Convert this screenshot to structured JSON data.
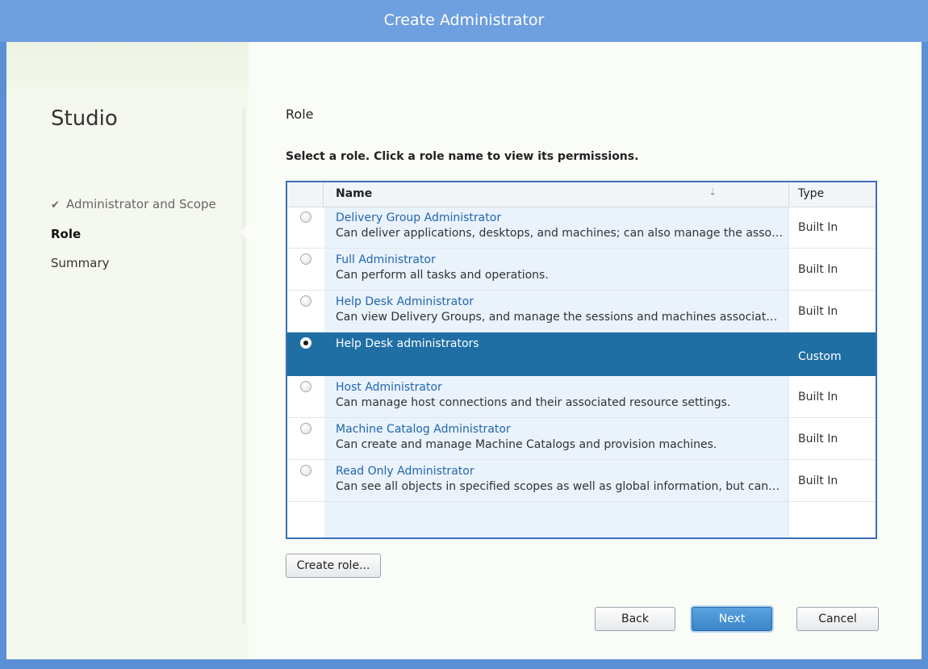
{
  "window": {
    "title": "Create Administrator"
  },
  "sidebar": {
    "app_name": "Studio",
    "steps": [
      {
        "label": "Administrator and Scope",
        "state": "done"
      },
      {
        "label": "Role",
        "state": "active"
      },
      {
        "label": "Summary",
        "state": "pending"
      }
    ]
  },
  "main": {
    "heading": "Role",
    "instruction": "Select a role. Click a role name to view its permissions.",
    "table": {
      "columns": {
        "name": "Name",
        "type": "Type"
      },
      "rows": [
        {
          "name": "Delivery Group Administrator",
          "description": "Can deliver applications, desktops, and machines; can also manage the associated sessions.",
          "type": "Built In",
          "selected": false
        },
        {
          "name": "Full Administrator",
          "description": "Can perform all tasks and operations.",
          "type": "Built In",
          "selected": false
        },
        {
          "name": "Help Desk Administrator",
          "description": "Can view Delivery Groups, and manage the sessions and machines associated with them.",
          "type": "Built In",
          "selected": false
        },
        {
          "name": "Help Desk administrators",
          "description": "",
          "type": "Custom",
          "selected": true
        },
        {
          "name": "Host Administrator",
          "description": "Can manage host connections and their associated resource settings.",
          "type": "Built In",
          "selected": false
        },
        {
          "name": "Machine Catalog Administrator",
          "description": "Can create and manage Machine Catalogs and provision machines.",
          "type": "Built In",
          "selected": false
        },
        {
          "name": "Read Only Administrator",
          "description": "Can see all objects in specified scopes as well as global information, but cannot change anything.",
          "type": "Built In",
          "selected": false
        }
      ]
    },
    "create_role_label": "Create role...",
    "buttons": {
      "back": "Back",
      "next": "Next",
      "cancel": "Cancel"
    }
  },
  "colors": {
    "title_bar": "#6e9fdf",
    "selected_row": "#1f6fa5",
    "link": "#2267ad",
    "table_border": "#3b6fb6"
  }
}
